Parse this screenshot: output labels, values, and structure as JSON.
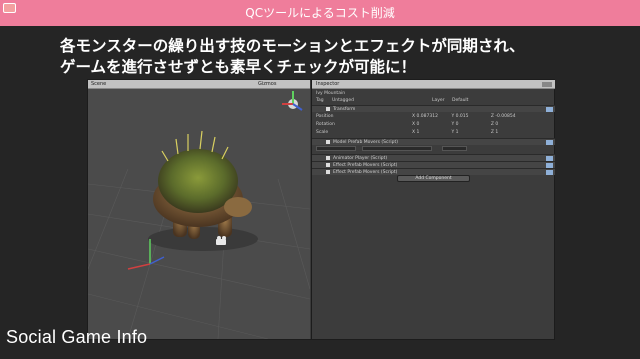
{
  "header": {
    "title": "QCツールによるコスト削減"
  },
  "headline": {
    "line1": "各モンスターの繰り出す技のモーションとエフェクトが同期され、",
    "line2": "ゲームを進行させずとも素早くチェックが可能に！"
  },
  "editor": {
    "scene": {
      "tab_label": "Scene",
      "right_label": "Gizmos"
    },
    "inspector": {
      "tab_label": "Inspector",
      "object_name": "Ivy Mountain",
      "tag_label": "Tag",
      "tag_value": "Untagged",
      "layer_label": "Layer",
      "layer_value": "Default",
      "transform_label": "Transform",
      "position_label": "Position",
      "rotation_label": "Rotation",
      "scale_label": "Scale",
      "position": [
        "X 0.087312",
        "Y 0.015",
        "Z -0.00854"
      ],
      "rotation": [
        "X 0",
        "Y 0",
        "Z 0"
      ],
      "scale": [
        "X 1",
        "Y 1",
        "Z 1"
      ],
      "components": [
        "Model Prefab Movers (Script)",
        "Animator Player (Script)",
        "Effect Prefab Movers (Script)",
        "Effect Prefab Movers (Script)"
      ],
      "add_component": "Add Component"
    }
  },
  "watermark": {
    "text": "Social Game Info"
  },
  "colors": {
    "header_bg": "#ef7d9b",
    "slide_bg": "#252525",
    "scene_bg": "#4b4b4b",
    "inspector_bg": "#3c3c3c"
  }
}
